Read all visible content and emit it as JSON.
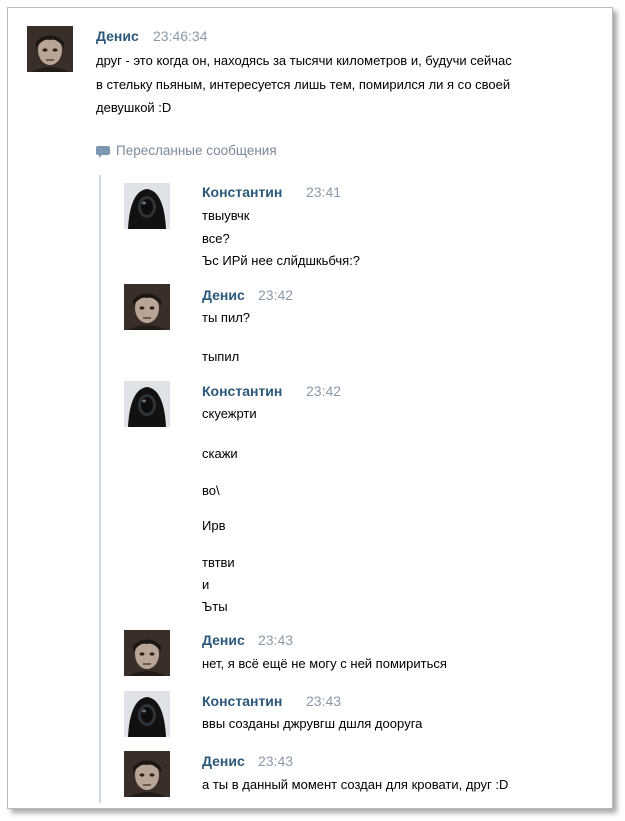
{
  "post": {
    "author": "Денис",
    "time": "23:46:34",
    "lines": [
      "друг - это когда он, находясь за тысячи километров и, будучи сейчас",
      "в стельку пьяным, интересуется лишь тем, помирился ли я со своей",
      "девушкой :D"
    ]
  },
  "forwarded": {
    "label": "Пересланные сообщения",
    "messages": [
      {
        "author": "Константин",
        "time": "23:41",
        "avatar": "dark-hooded-avatar",
        "lines": [
          "твыувчк",
          "все?",
          "Ъс ИРй нее слйдшкьбчя:?"
        ]
      },
      {
        "author": "Денис",
        "time": "23:42",
        "avatar": "photo-avatar",
        "lines": [
          "ты пил?",
          "тыпил"
        ]
      },
      {
        "author": "Константин",
        "time": "23:42",
        "avatar": "dark-hooded-avatar",
        "lines": [
          "скуежрти",
          "скажи",
          "во\\",
          "Ирв",
          "твтви",
          "и",
          "Ъты"
        ]
      },
      {
        "author": "Денис",
        "time": "23:43",
        "avatar": "photo-avatar",
        "lines": [
          "нет, я всё ещё не могу с ней помириться"
        ]
      },
      {
        "author": "Константин",
        "time": "23:43",
        "avatar": "dark-hooded-avatar",
        "lines": [
          "ввы созданы джрувгш дшля доорyга"
        ]
      },
      {
        "author": "Денис",
        "time": "23:43",
        "avatar": "photo-avatar",
        "lines": [
          "а ты в данный момент создан для кровати, друг :D"
        ]
      }
    ]
  },
  "colors": {
    "author": "#2b587a",
    "time": "#8a9aa9",
    "forward_bar": "#cfd8e1"
  }
}
